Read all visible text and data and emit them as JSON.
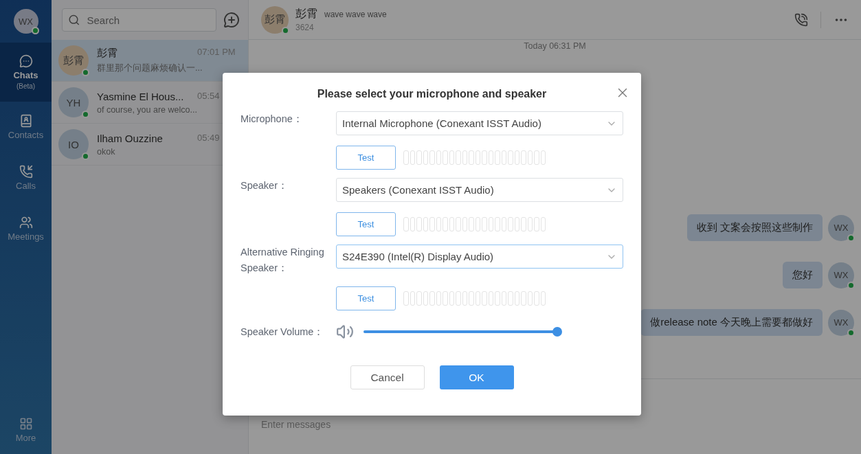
{
  "sidebar": {
    "user": {
      "initials": "WX",
      "online": true
    },
    "nav": [
      {
        "label": "Chats",
        "sublabel": "(Beta)",
        "kind": "chats",
        "selected": true
      },
      {
        "label": "Contacts",
        "kind": "contacts",
        "selected": false
      },
      {
        "label": "Calls",
        "kind": "calls",
        "selected": false
      },
      {
        "label": "Meetings",
        "kind": "meetings",
        "selected": false
      }
    ],
    "more": "More"
  },
  "chat_list": {
    "search_placeholder": "Search",
    "conversations": [
      {
        "avatar": "彭霄",
        "name": "彭霄",
        "preview": "群里那个问题麻烦确认一...",
        "time": "07:01 PM",
        "online": true,
        "selected": true
      },
      {
        "avatar": "YH",
        "name": "Yasmine El Hous...",
        "preview": "of course, you are welco...",
        "time": "05:54",
        "online": true,
        "selected": false
      },
      {
        "avatar": "IO",
        "name": "Ilham Ouzzine",
        "preview": "okok",
        "time": "05:49",
        "online": true,
        "selected": false
      }
    ]
  },
  "chat": {
    "header": {
      "avatar": "彭霄",
      "name": "彭霄",
      "status": "wave wave wave",
      "number": "3624",
      "online": true
    },
    "date": "Today 06:31 PM",
    "messages": [
      {
        "text": "收到 文案会按照这些制作",
        "avatar": "WX",
        "online": true
      },
      {
        "text": "您好",
        "avatar": "WX",
        "online": true
      },
      {
        "text": "做release note 今天晚上需要都做好",
        "avatar": "WX",
        "online": true
      }
    ],
    "composer_placeholder": "Enter messages"
  },
  "dialog": {
    "title": "Please select your microphone and speaker",
    "devices": [
      {
        "label": "Microphone：",
        "value": "Internal Microphone (Conexant ISST Audio)",
        "focused": false,
        "test_button": "Test"
      },
      {
        "label": "Speaker：",
        "value": "Speakers (Conexant ISST Audio)",
        "focused": false,
        "test_button": "Test"
      },
      {
        "label": "Alternative Ringing Speaker：",
        "value": "S24E390 (Intel(R) Display Audio)",
        "focused": true,
        "test_button": "Test"
      }
    ],
    "volume": {
      "label": "Speaker Volume：",
      "level": 1
    },
    "buttons": [
      {
        "label": "Cancel",
        "kind": "secondary"
      },
      {
        "label": "OK",
        "kind": "primary"
      }
    ]
  }
}
